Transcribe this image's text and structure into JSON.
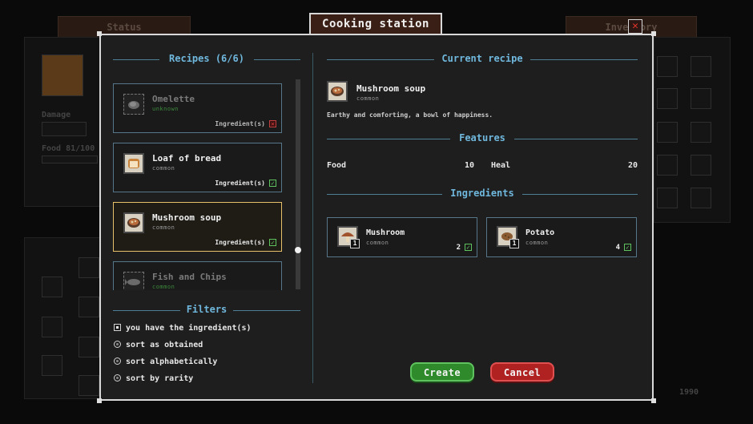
{
  "background": {
    "status_tab": "Status",
    "inventory_tab": "Inventory",
    "damage_label": "Damage",
    "food_label": "Food 81/100",
    "money": "1990"
  },
  "dialog": {
    "title": "Cooking station",
    "close_symbol": "✕"
  },
  "recipes": {
    "header": "Recipes (6/6)",
    "items": [
      {
        "name": "Omelette",
        "rarity": "unknown",
        "ingredients_label": "Ingredient(s)",
        "ingredients_ok": false,
        "locked": true,
        "icon": "locked-omelette-icon"
      },
      {
        "name": "Loaf of bread",
        "rarity": "common",
        "ingredients_label": "Ingredient(s)",
        "ingredients_ok": true,
        "locked": false,
        "icon": "bread-icon"
      },
      {
        "name": "Mushroom soup",
        "rarity": "common",
        "ingredients_label": "Ingredient(s)",
        "ingredients_ok": true,
        "locked": false,
        "selected": true,
        "icon": "soup-bowl-icon"
      },
      {
        "name": "Fish and Chips",
        "rarity": "common",
        "locked": true,
        "icon": "locked-fish-icon"
      }
    ]
  },
  "filters": {
    "header": "Filters",
    "options": [
      {
        "label": "you have the ingredient(s)",
        "kind": "checkbox",
        "checked": true
      },
      {
        "label": "sort as obtained",
        "kind": "radio"
      },
      {
        "label": "sort alphabetically",
        "kind": "radio"
      },
      {
        "label": "sort by rarity",
        "kind": "radio"
      }
    ]
  },
  "current_recipe": {
    "header": "Current recipe",
    "name": "Mushroom soup",
    "rarity": "common",
    "description": "Earthy and comforting, a bowl of happiness.",
    "features_header": "Features",
    "features": [
      {
        "label": "Food",
        "value": "10"
      },
      {
        "label": "Heal",
        "value": "20"
      }
    ],
    "ingredients_header": "Ingredients",
    "ingredients": [
      {
        "name": "Mushroom",
        "rarity": "common",
        "required": "1",
        "have": "2",
        "ok": true
      },
      {
        "name": "Potato",
        "rarity": "common",
        "required": "1",
        "have": "4",
        "ok": true
      }
    ]
  },
  "actions": {
    "create": "Create",
    "cancel": "Cancel"
  },
  "colors": {
    "accent": "#6fb7dc",
    "selected_border": "#e6c06a",
    "create_green": "#2e8a2a",
    "cancel_red": "#b02222"
  }
}
